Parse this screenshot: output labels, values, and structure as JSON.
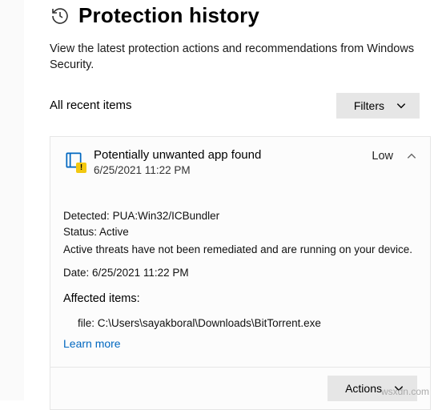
{
  "header": {
    "title": "Protection history",
    "subtitle": "View the latest protection actions and recommendations from Windows Security."
  },
  "toolbar": {
    "recent_label": "All recent items",
    "filters_label": "Filters"
  },
  "card": {
    "title": "Potentially unwanted app found",
    "timestamp": "6/25/2021 11:22 PM",
    "severity": "Low",
    "details": {
      "detected_label": "Detected:",
      "detected_value": "PUA:Win32/ICBundler",
      "status_label": "Status:",
      "status_value": "Active",
      "remediation_text": "Active threats have not been remediated and are running on your device.",
      "date_label": "Date:",
      "date_value": "6/25/2021 11:22 PM",
      "affected_label": "Affected items:",
      "file_label": "file:",
      "file_value": "C:\\Users\\sayakboral\\Downloads\\BitTorrent.exe",
      "learn_more": "Learn more"
    },
    "actions_label": "Actions"
  },
  "watermark": "wsxdn.com"
}
